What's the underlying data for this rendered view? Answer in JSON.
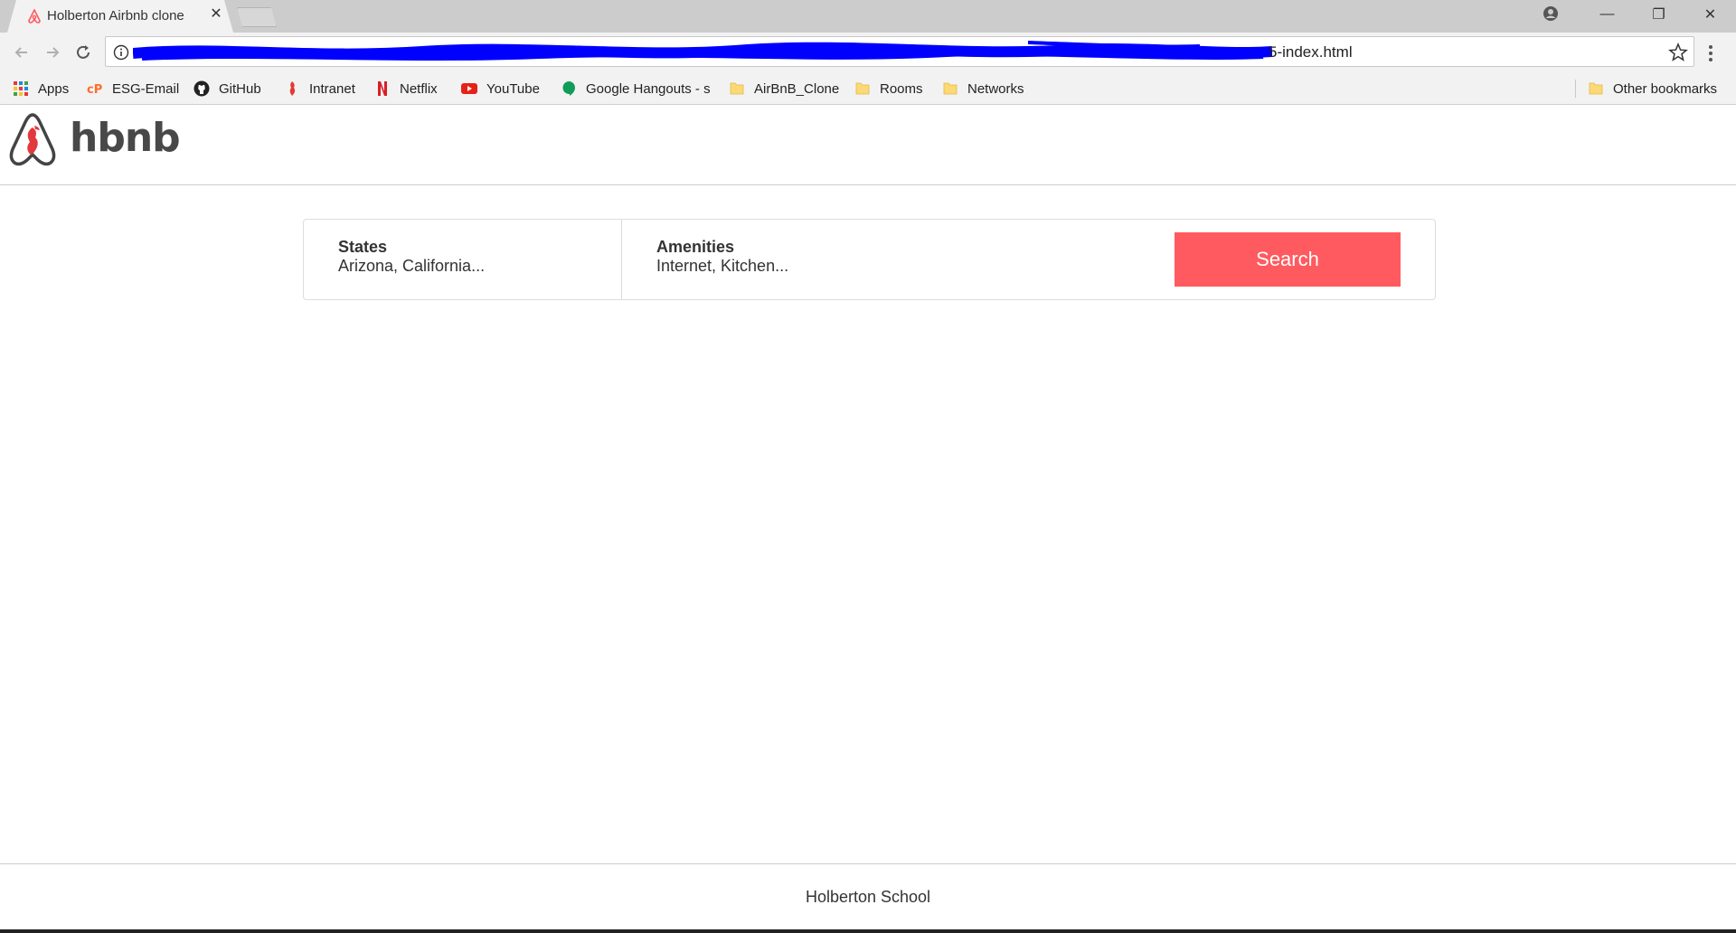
{
  "browser": {
    "tab_title": "Holberton Airbnb clone",
    "tab_close": "✕",
    "url_visible": "5-index.html",
    "window_controls": {
      "minimize": "—",
      "maximize": "❐",
      "close": "✕"
    }
  },
  "bookmarks": [
    {
      "label": "Apps",
      "icon": "apps-grid-icon"
    },
    {
      "label": "ESG-Email",
      "icon": "cpanel-icon"
    },
    {
      "label": "GitHub",
      "icon": "github-icon"
    },
    {
      "label": "Intranet",
      "icon": "intranet-icon"
    },
    {
      "label": "Netflix",
      "icon": "netflix-icon"
    },
    {
      "label": "YouTube",
      "icon": "youtube-icon"
    },
    {
      "label": "Google Hangouts - s",
      "icon": "hangouts-icon"
    },
    {
      "label": "AirBnB_Clone",
      "icon": "folder-icon"
    },
    {
      "label": "Rooms",
      "icon": "folder-icon"
    },
    {
      "label": "Networks",
      "icon": "folder-icon"
    },
    {
      "label": "Other bookmarks",
      "icon": "folder-icon"
    }
  ],
  "header": {
    "logo_text": "hbnb"
  },
  "filters": {
    "states": {
      "title": "States",
      "value": "Arizona, California..."
    },
    "amenities": {
      "title": "Amenities",
      "value": "Internet, Kitchen..."
    },
    "search_label": "Search"
  },
  "footer": {
    "text": "Holberton School"
  },
  "colors": {
    "accent": "#ff5a5f",
    "chrome": "#f2f2f2",
    "redaction": "#0000ff"
  }
}
